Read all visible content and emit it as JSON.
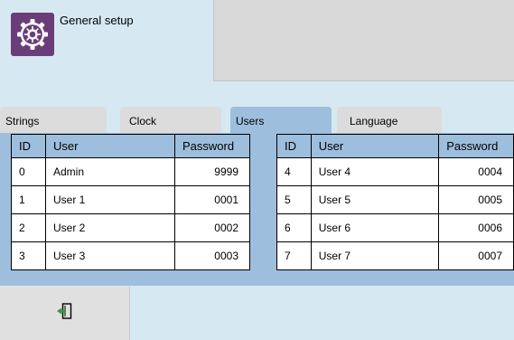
{
  "header": {
    "title": "General setup",
    "icon": "gear-icon",
    "icon_bg": "#6b3d78"
  },
  "tabs": [
    {
      "label": "Strings",
      "active": false
    },
    {
      "label": "Clock",
      "active": false
    },
    {
      "label": "Users",
      "active": true
    },
    {
      "label": "Language",
      "active": false
    }
  ],
  "table": {
    "columns": [
      "ID",
      "User",
      "Password"
    ],
    "left_rows": [
      {
        "id": "0",
        "user": "Admin",
        "password": "9999"
      },
      {
        "id": "1",
        "user": "User 1",
        "password": "0001"
      },
      {
        "id": "2",
        "user": "User 2",
        "password": "0002"
      },
      {
        "id": "3",
        "user": "User 3",
        "password": "0003"
      }
    ],
    "right_rows": [
      {
        "id": "4",
        "user": "User 4",
        "password": "0004"
      },
      {
        "id": "5",
        "user": "User 5",
        "password": "0005"
      },
      {
        "id": "6",
        "user": "User 6",
        "password": "0006"
      },
      {
        "id": "7",
        "user": "User 7",
        "password": "0007"
      }
    ]
  },
  "footer": {
    "exit_icon": "exit-icon"
  },
  "colors": {
    "background": "#d6e9f2",
    "tab_active": "#9ebedd",
    "tab_inactive": "#dcdcdc",
    "accent_green": "#2e9b3f"
  }
}
